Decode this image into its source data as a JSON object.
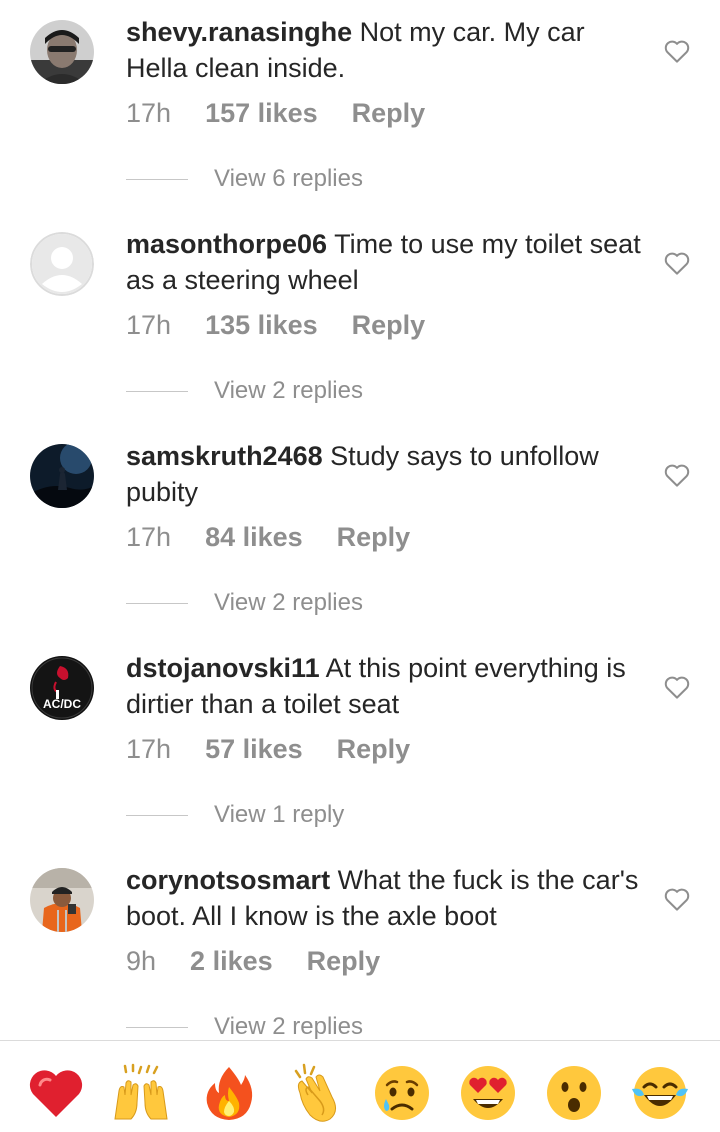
{
  "comments": [
    {
      "username": "shevy.ranasinghe",
      "text": "Not my car. My car Hella clean inside.",
      "time": "17h",
      "likes": "157 likes",
      "reply": "Reply",
      "view_replies": "View 6 replies",
      "avatar": "photo-avatar-person"
    },
    {
      "username": "masonthorpe06",
      "text": "Time to use my toilet seat as a steering wheel",
      "time": "17h",
      "likes": "135 likes",
      "reply": "Reply",
      "view_replies": "View 2 replies",
      "avatar": "default-avatar"
    },
    {
      "username": "samskruth2468",
      "text": "Study says to unfollow pubity",
      "time": "17h",
      "likes": "84 likes",
      "reply": "Reply",
      "view_replies": "View 2 replies",
      "avatar": "photo-avatar-night"
    },
    {
      "username": "dstojanovski11",
      "text": "At this point everything is dirtier than a toilet seat",
      "time": "17h",
      "likes": "57 likes",
      "reply": "Reply",
      "view_replies": "View 1 reply",
      "avatar": "acdc-logo-avatar",
      "avatar_text": "AC/DC"
    },
    {
      "username": "corynotsosmart",
      "text": "What the fuck is the car's boot. All I know is the axle boot",
      "time": "9h",
      "likes": "2 likes",
      "reply": "Reply",
      "view_replies": "View 2 replies",
      "avatar": "photo-avatar-orange-jacket"
    }
  ],
  "reactions": [
    "red-heart",
    "raising-hands",
    "fire",
    "clapping-hands",
    "sad-face",
    "heart-eyes",
    "surprised-face",
    "tears-of-joy"
  ],
  "colors": {
    "text": "#262626",
    "secondary": "#8e8e8e",
    "divider": "#dbdbdb"
  }
}
